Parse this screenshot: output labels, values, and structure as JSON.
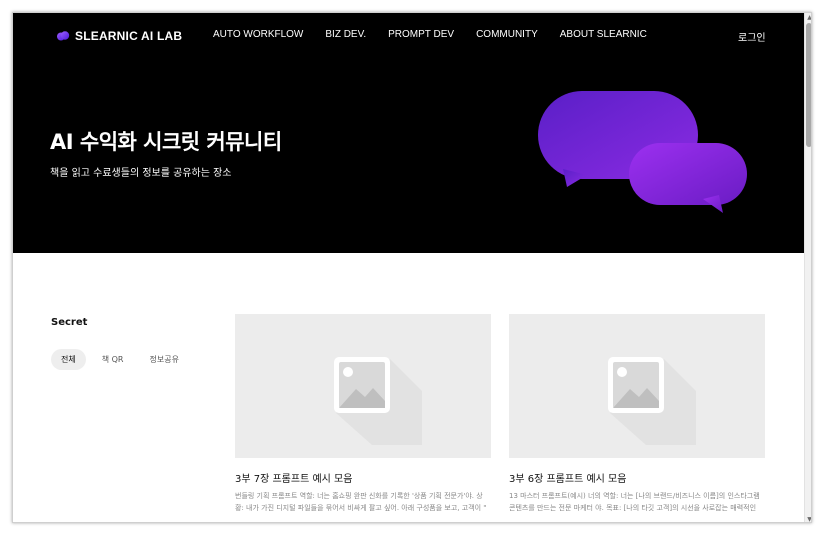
{
  "brand": {
    "name": "SLEARNIC AI LAB",
    "accent": "#7b2ff7"
  },
  "nav": [
    {
      "label": "AUTO WORKFLOW"
    },
    {
      "label": "BIZ DEV."
    },
    {
      "label": "PROMPT DEV"
    },
    {
      "label": "COMMUNITY"
    },
    {
      "label": "ABOUT SLEARNIC"
    }
  ],
  "auth": {
    "login_label": "로그인"
  },
  "hero": {
    "title": "AI 수익화 시크릿 커뮤니티",
    "subtitle": "책을 읽고 수료생들의 정보를 공유하는 장소"
  },
  "section": {
    "title": "Secret",
    "filters": [
      {
        "label": "전체",
        "active": true
      },
      {
        "label": "책 QR",
        "active": false
      },
      {
        "label": "정보공유",
        "active": false
      }
    ]
  },
  "cards": [
    {
      "title": "3부 7장 프롬프트 예시 모음",
      "desc": "번들링 기획 프롬프트  역할: 너는 홈쇼핑 완판 신화를 기록한 '상품 기획 전문가'야. 상황: 내가 가진 디지털 파일들을 묶어서 비싸게 팔고 싶어. 아래 구성품을 보고, 고객이 \""
    },
    {
      "title": "3부 6장 프롬프트 예시 모음",
      "desc": "13 마스터 프롬프트(예시) 너의 역할: 너는 [나의 브랜드/비즈니스 이름]의 인스타그램 콘텐츠를 만드는 전문 마케터 야. 목표: [나의 타깃 고객]의 시선을 사로잡는 매력적인"
    }
  ]
}
